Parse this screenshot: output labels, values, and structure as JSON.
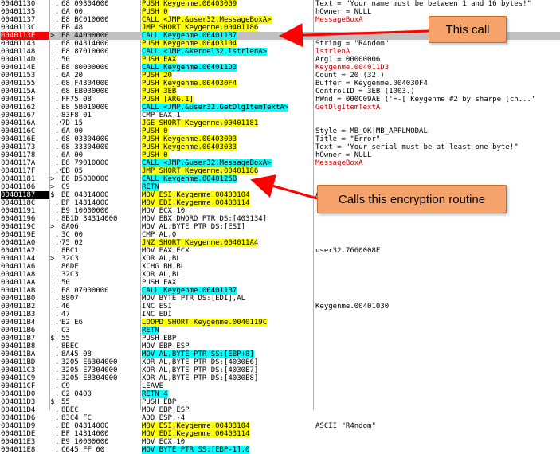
{
  "rows": [
    {
      "addr": "00401130",
      "flag": "",
      "gut": ".",
      "hex": "68 09304000",
      "asm": "PUSH Keygenme.00403009",
      "asm_hl": "yellow",
      "cmt": "Text = \"Your name must be between 1 and 16 bytes!\"",
      "cmt_red": false,
      "style": ""
    },
    {
      "addr": "00401135",
      "flag": "",
      "gut": ".",
      "hex": "6A 00",
      "asm": "PUSH 0",
      "asm_hl": "yellow",
      "cmt": "hOwner = NULL",
      "cmt_red": false,
      "style": ""
    },
    {
      "addr": "00401137",
      "flag": "",
      "gut": ".",
      "hex": "E8 BC010000",
      "asm": "CALL <JMP.&user32.MessageBoxA>",
      "asm_hl": "yellow",
      "cmt": "MessageBoxA",
      "cmt_red": true,
      "style": ""
    },
    {
      "addr": "0040113C",
      "flag": "",
      "gut": ".",
      "hex": "EB 48",
      "asm": "JMP SHORT Keygenme.00401186",
      "asm_hl": "yellow",
      "cmt": "",
      "cmt_red": false,
      "style": ""
    },
    {
      "addr": "0040113E",
      "flag": ">",
      "gut": "",
      "hex": "E8 44000000",
      "asm": "CALL Keygenme.00401187",
      "asm_hl": "cyan",
      "cmt": "",
      "cmt_red": false,
      "style": "bp"
    },
    {
      "addr": "00401143",
      "flag": "",
      "gut": ".",
      "hex": "68 04314000",
      "asm": "PUSH Keygenme.00403104",
      "asm_hl": "yellow",
      "cmt": "String = \"R4ndom\"",
      "cmt_red": false,
      "style": ""
    },
    {
      "addr": "00401148",
      "flag": "",
      "gut": ".",
      "hex": "E8 87010000",
      "asm": "CALL <JMP.&kernel32.lstrlenA>",
      "asm_hl": "cyan",
      "cmt": "lstrlenA",
      "cmt_red": true,
      "style": ""
    },
    {
      "addr": "0040114D",
      "flag": "",
      "gut": ".",
      "hex": "50",
      "asm": "PUSH EAX",
      "asm_hl": "yellow",
      "cmt": "Arg1 = 00000006",
      "cmt_red": false,
      "style": ""
    },
    {
      "addr": "0040114E",
      "flag": "",
      "gut": ".",
      "hex": "E8 80000000",
      "asm": "CALL Keygenme.004011D3",
      "asm_hl": "cyan",
      "cmt": "Keygenme.004011D3",
      "cmt_red": true,
      "style": ""
    },
    {
      "addr": "00401153",
      "flag": "",
      "gut": ".",
      "hex": "6A 20",
      "asm": "PUSH 20",
      "asm_hl": "yellow",
      "cmt": "Count = 20 (32.)",
      "cmt_red": false,
      "style": ""
    },
    {
      "addr": "00401155",
      "flag": "",
      "gut": ".",
      "hex": "68 F4304000",
      "asm": "PUSH Keygenme.004030F4",
      "asm_hl": "yellow",
      "cmt": "Buffer = Keygenme.004030F4",
      "cmt_red": false,
      "style": ""
    },
    {
      "addr": "0040115A",
      "flag": "",
      "gut": ".",
      "hex": "68 EB030000",
      "asm": "PUSH 3EB",
      "asm_hl": "yellow",
      "cmt": "ControlID = 3EB (1003.)",
      "cmt_red": false,
      "style": ""
    },
    {
      "addr": "0040115F",
      "flag": "",
      "gut": ".",
      "hex": "FF75 08",
      "asm": "PUSH [ARG.1]",
      "asm_hl": "yellow",
      "cmt": "hWnd = 000C09AE ('=-[ Keygenme #2 by sharpe [ch...'",
      "cmt_red": false,
      "style": ""
    },
    {
      "addr": "00401162",
      "flag": "",
      "gut": ".",
      "hex": "E8 5B010000",
      "asm": "CALL <JMP.&user32.GetDlgItemTextA>",
      "asm_hl": "cyan",
      "cmt": "GetDlgItemTextA",
      "cmt_red": true,
      "style": ""
    },
    {
      "addr": "00401167",
      "flag": "",
      "gut": ".",
      "hex": "83F8 01",
      "asm": "CMP EAX,1",
      "asm_hl": "",
      "cmt": "",
      "cmt_red": false,
      "style": ""
    },
    {
      "addr": "0040116A",
      "flag": "",
      "gut": ".v",
      "hex": "7D 15",
      "asm": "JGE SHORT Keygenme.00401181",
      "asm_hl": "yellow",
      "cmt": "",
      "cmt_red": false,
      "style": ""
    },
    {
      "addr": "0040116C",
      "flag": "",
      "gut": ".",
      "hex": "6A 00",
      "asm": "PUSH 0",
      "asm_hl": "yellow",
      "cmt": "Style = MB_OK|MB_APPLMODAL",
      "cmt_red": false,
      "style": ""
    },
    {
      "addr": "0040116E",
      "flag": "",
      "gut": ".",
      "hex": "68 03304000",
      "asm": "PUSH Keygenme.00403003",
      "asm_hl": "yellow",
      "cmt": "Title = \"Error\"",
      "cmt_red": false,
      "style": ""
    },
    {
      "addr": "00401173",
      "flag": "",
      "gut": ".",
      "hex": "68 33304000",
      "asm": "PUSH Keygenme.00403033",
      "asm_hl": "yellow",
      "cmt": "Text = \"Your serial must be at least one byte!\"",
      "cmt_red": false,
      "style": ""
    },
    {
      "addr": "00401178",
      "flag": "",
      "gut": ".",
      "hex": "6A 00",
      "asm": "PUSH 0",
      "asm_hl": "yellow",
      "cmt": "hOwner = NULL",
      "cmt_red": false,
      "style": ""
    },
    {
      "addr": "0040117A",
      "flag": "",
      "gut": ".",
      "hex": "E8 79010000",
      "asm": "CALL <JMP.&user32.MessageBoxA>",
      "asm_hl": "cyan",
      "cmt": "MessageBoxA",
      "cmt_red": true,
      "style": ""
    },
    {
      "addr": "0040117F",
      "flag": "",
      "gut": ".v",
      "hex": "EB 05",
      "asm": "JMP SHORT Keygenme.00401186",
      "asm_hl": "yellow",
      "cmt": "",
      "cmt_red": false,
      "style": ""
    },
    {
      "addr": "00401181",
      "flag": ">",
      "gut": "",
      "hex": "E8 D5000000",
      "asm": "CALL Keygenme.0040125B",
      "asm_hl": "cyan",
      "cmt": "",
      "cmt_red": false,
      "style": ""
    },
    {
      "addr": "00401186",
      "flag": ">",
      "gut": "",
      "hex": "C9",
      "asm": "RETN",
      "asm_hl": "cyan",
      "cmt": "",
      "cmt_red": false,
      "style": ""
    },
    {
      "addr": "00401187",
      "flag": "$",
      "gut": "",
      "hex": "BE 04314000",
      "asm": "MOV ESI,Keygenme.00403104",
      "asm_hl": "yellow",
      "cmt": "ASCII \"R4ndom\"",
      "cmt_red": false,
      "style": "sel"
    },
    {
      "addr": "0040118C",
      "flag": "",
      "gut": ".",
      "hex": "BF 14314000",
      "asm": "MOV EDI,Keygenme.00403114",
      "asm_hl": "yellow",
      "cmt": "",
      "cmt_red": false,
      "style": ""
    },
    {
      "addr": "00401191",
      "flag": "",
      "gut": ".",
      "hex": "B9 10000000",
      "asm": "MOV ECX,10",
      "asm_hl": "",
      "cmt": "",
      "cmt_red": false,
      "style": ""
    },
    {
      "addr": "00401196",
      "flag": "",
      "gut": ".",
      "hex": "8B1D 34314000",
      "asm": "MOV EBX,DWORD PTR DS:[403134]",
      "asm_hl": "",
      "cmt": "",
      "cmt_red": false,
      "style": ""
    },
    {
      "addr": "0040119C",
      "flag": ">",
      "gut": "",
      "hex": "8A06",
      "asm": "MOV AL,BYTE PTR DS:[ESI]",
      "asm_hl": "",
      "cmt": "",
      "cmt_red": false,
      "style": ""
    },
    {
      "addr": "0040119E",
      "flag": "",
      "gut": ".",
      "hex": "3C 00",
      "asm": "CMP AL,0",
      "asm_hl": "",
      "cmt": "",
      "cmt_red": false,
      "style": ""
    },
    {
      "addr": "004011A0",
      "flag": "",
      "gut": ".v",
      "hex": "75 02",
      "asm": "JNZ SHORT Keygenme.004011A4",
      "asm_hl": "yellow",
      "cmt": "",
      "cmt_red": false,
      "style": ""
    },
    {
      "addr": "004011A2",
      "flag": "",
      "gut": ".",
      "hex": "8BC1",
      "asm": "MOV EAX,ECX",
      "asm_hl": "",
      "cmt": "user32.7660008E",
      "cmt_red": false,
      "style": ""
    },
    {
      "addr": "004011A4",
      "flag": ">",
      "gut": "",
      "hex": "32C3",
      "asm": "XOR AL,BL",
      "asm_hl": "",
      "cmt": "",
      "cmt_red": false,
      "style": ""
    },
    {
      "addr": "004011A6",
      "flag": "",
      "gut": ".",
      "hex": "86DF",
      "asm": "XCHG BH,BL",
      "asm_hl": "",
      "cmt": "",
      "cmt_red": false,
      "style": ""
    },
    {
      "addr": "004011A8",
      "flag": "",
      "gut": ".",
      "hex": "32C3",
      "asm": "XOR AL,BL",
      "asm_hl": "",
      "cmt": "",
      "cmt_red": false,
      "style": ""
    },
    {
      "addr": "004011AA",
      "flag": "",
      "gut": ".",
      "hex": "50",
      "asm": "PUSH EAX",
      "asm_hl": "",
      "cmt": "",
      "cmt_red": false,
      "style": ""
    },
    {
      "addr": "004011AB",
      "flag": "",
      "gut": ".",
      "hex": "E8 07000000",
      "asm": "CALL Keygenme.004011B7",
      "asm_hl": "cyan",
      "cmt": "",
      "cmt_red": false,
      "style": ""
    },
    {
      "addr": "004011B0",
      "flag": "",
      "gut": ".",
      "hex": "8807",
      "asm": "MOV BYTE PTR DS:[EDI],AL",
      "asm_hl": "",
      "cmt": "",
      "cmt_red": false,
      "style": ""
    },
    {
      "addr": "004011B2",
      "flag": "",
      "gut": ".",
      "hex": "46",
      "asm": "INC ESI",
      "asm_hl": "",
      "cmt": "Keygenme.00401030",
      "cmt_red": false,
      "style": ""
    },
    {
      "addr": "004011B3",
      "flag": "",
      "gut": ".",
      "hex": "47",
      "asm": "INC EDI",
      "asm_hl": "",
      "cmt": "",
      "cmt_red": false,
      "style": ""
    },
    {
      "addr": "004011B4",
      "flag": "",
      "gut": ".^",
      "hex": "E2 E6",
      "asm": "LOOPD SHORT Keygenme.0040119C",
      "asm_hl": "yellow",
      "cmt": "",
      "cmt_red": false,
      "style": ""
    },
    {
      "addr": "004011B6",
      "flag": "",
      "gut": ".",
      "hex": "C3",
      "asm": "RETN",
      "asm_hl": "cyan",
      "cmt": "",
      "cmt_red": false,
      "style": ""
    },
    {
      "addr": "004011B7",
      "flag": "$",
      "gut": "",
      "hex": "55",
      "asm": "PUSH EBP",
      "asm_hl": "",
      "cmt": "",
      "cmt_red": false,
      "style": ""
    },
    {
      "addr": "004011B8",
      "flag": "",
      "gut": ".",
      "hex": "8BEC",
      "asm": "MOV EBP,ESP",
      "asm_hl": "",
      "cmt": "",
      "cmt_red": false,
      "style": ""
    },
    {
      "addr": "004011BA",
      "flag": "",
      "gut": ".",
      "hex": "8A45 08",
      "asm": "MOV AL,BYTE PTR SS:[EBP+8]",
      "asm_hl": "cyan",
      "cmt": "",
      "cmt_red": false,
      "style": ""
    },
    {
      "addr": "004011BD",
      "flag": "",
      "gut": ".",
      "hex": "3205 E6304000",
      "asm": "XOR AL,BYTE PTR DS:[4030E6]",
      "asm_hl": "",
      "cmt": "",
      "cmt_red": false,
      "style": ""
    },
    {
      "addr": "004011C3",
      "flag": "",
      "gut": ".",
      "hex": "3205 E7304000",
      "asm": "XOR AL,BYTE PTR DS:[4030E7]",
      "asm_hl": "",
      "cmt": "",
      "cmt_red": false,
      "style": ""
    },
    {
      "addr": "004011C9",
      "flag": "",
      "gut": ".",
      "hex": "3205 E8304000",
      "asm": "XOR AL,BYTE PTR DS:[4030E8]",
      "asm_hl": "",
      "cmt": "",
      "cmt_red": false,
      "style": ""
    },
    {
      "addr": "004011CF",
      "flag": "",
      "gut": ".",
      "hex": "C9",
      "asm": "LEAVE",
      "asm_hl": "",
      "cmt": "",
      "cmt_red": false,
      "style": ""
    },
    {
      "addr": "004011D0",
      "flag": "",
      "gut": ".",
      "hex": "C2 0400",
      "asm": "RETN 4",
      "asm_hl": "cyan",
      "cmt": "",
      "cmt_red": false,
      "style": ""
    },
    {
      "addr": "004011D3",
      "flag": "$",
      "gut": "",
      "hex": "55",
      "asm": "PUSH EBP",
      "asm_hl": "",
      "cmt": "",
      "cmt_red": false,
      "style": ""
    },
    {
      "addr": "004011D4",
      "flag": "",
      "gut": ".",
      "hex": "8BEC",
      "asm": "MOV EBP,ESP",
      "asm_hl": "",
      "cmt": "",
      "cmt_red": false,
      "style": ""
    },
    {
      "addr": "004011D6",
      "flag": "",
      "gut": ".",
      "hex": "83C4 FC",
      "asm": "ADD ESP,-4",
      "asm_hl": "",
      "cmt": "",
      "cmt_red": false,
      "style": ""
    },
    {
      "addr": "004011D9",
      "flag": "",
      "gut": ".",
      "hex": "BE 04314000",
      "asm": "MOV ESI,Keygenme.00403104",
      "asm_hl": "yellow",
      "cmt": "ASCII \"R4ndom\"",
      "cmt_red": false,
      "style": ""
    },
    {
      "addr": "004011DE",
      "flag": "",
      "gut": ".",
      "hex": "BF 14314000",
      "asm": "MOV EDI,Keygenme.00403114",
      "asm_hl": "yellow",
      "cmt": "",
      "cmt_red": false,
      "style": ""
    },
    {
      "addr": "004011E3",
      "flag": "",
      "gut": ".",
      "hex": "B9 10000000",
      "asm": "MOV ECX,10",
      "asm_hl": "",
      "cmt": "",
      "cmt_red": false,
      "style": ""
    },
    {
      "addr": "004011E8",
      "flag": "",
      "gut": ".",
      "hex": "C645 FF 00",
      "asm": "MOV BYTE PTR SS:[EBP-1],0",
      "asm_hl": "cyan",
      "cmt": "",
      "cmt_red": false,
      "style": ""
    }
  ],
  "callout_this_call": "This call",
  "callout_encryption": "Calls this encryption routine",
  "colors": {
    "arrow": "#ff0000",
    "callout_fill": "#f5a36a",
    "jump_highlight": "#ffff00",
    "call_highlight": "#00ffff",
    "breakpoint": "#ff0000"
  }
}
